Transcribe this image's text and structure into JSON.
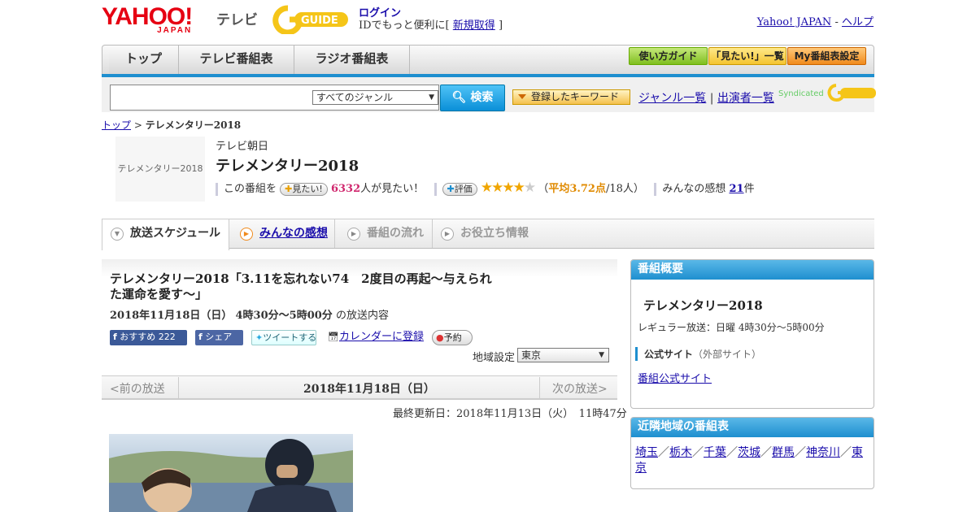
{
  "header": {
    "logo_yahoo": "YAHOO!",
    "logo_japan": "JAPAN",
    "logo_tv": "テレビ",
    "logo_gguide": "GUIDE",
    "login_label": "ログイン",
    "login_prefix": "IDでもっと便利に[",
    "register_label": "新規取得",
    "login_suffix": "]",
    "yahoo_japan_link": "Yahoo! JAPAN",
    "separator": " - ",
    "help_link": "ヘルプ"
  },
  "nav": {
    "tabs": [
      "トップ",
      "テレビ番組表",
      "ラジオ番組表"
    ],
    "guide_buttons": [
      "使い方ガイド",
      "「見たい!」一覧",
      "My番組表設定"
    ]
  },
  "search": {
    "genre_selected": "すべてのジャンル",
    "search_button": "検索",
    "keyword_button": "登録したキーワード",
    "genre_list_link": "ジャンル一覧",
    "link_sep": "|",
    "cast_list_link": "出演者一覧",
    "syndicated": "Syndicated"
  },
  "breadcrumb": {
    "top": "トップ",
    "sep": ">",
    "current": "テレメンタリー2018"
  },
  "program": {
    "image_text": "テレメンタリー2018",
    "station": "テレビ朝日",
    "title": "テレメンタリー2018",
    "want_prefix": "この番組を",
    "want_button": "見たい!",
    "want_count": "6332",
    "want_suffix": "人が見たい！",
    "rate_button": "評価",
    "rating": 3.72,
    "rating_label": "平均3.72点",
    "rating_open": "（",
    "rating_voters": "/18人）",
    "impressions_label": "みんなの感想",
    "impressions_count": "21",
    "impressions_unit": "件"
  },
  "content_tabs": [
    "放送スケジュール",
    "みんなの感想",
    "番組の流れ",
    "お役立ち情報"
  ],
  "episode": {
    "title": "テレメンタリー2018「3.11を忘れない74　2度目の再起～与えられた運命を愛す～」",
    "date": "2018年11月18日（日）",
    "time": "4時30分～5時00分",
    "date_suffix": "の放送内容",
    "fb_recommend": "おすすめ",
    "fb_count": "222",
    "fb_share": "シェア",
    "tweet": "ツイートする",
    "calendar": "カレンダーに登録",
    "reserve": "予約",
    "region_label": "地域設定",
    "region_selected": "東京"
  },
  "pager": {
    "prev": "<前の放送",
    "date": "2018年11月18日（日）",
    "next": "次の放送>"
  },
  "updated": "最終更新日：2018年11月13日（火）　11時47分",
  "sidebar": {
    "overview_head": "番組概要",
    "overview_title": "テレメンタリー2018",
    "regular": "レギュラー放送：日曜 4時30分～5時00分",
    "official_label": "公式サイト",
    "official_note": "（外部サイト）",
    "official_link": "番組公式サイト",
    "nearby_head": "近隣地域の番組表",
    "nearby": [
      "埼玉",
      "栃木",
      "千葉",
      "茨城",
      "群馬",
      "神奈川",
      "東京"
    ]
  },
  "colors": {
    "accent_blue": "#1e8fcf",
    "yahoo_red": "#e60012",
    "star": "#f0a500",
    "gguide_yellow": "#f5c518"
  }
}
